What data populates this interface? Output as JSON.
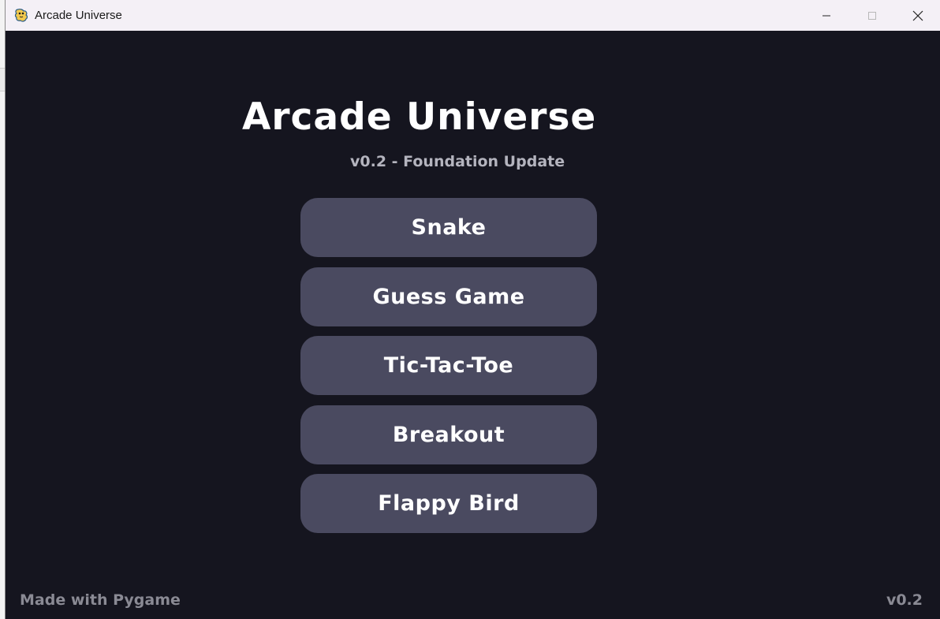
{
  "window": {
    "title": "Arcade Universe",
    "icon": "pygame-snake-icon",
    "controls": [
      "minimize-icon",
      "maximize-icon",
      "close-icon"
    ]
  },
  "game": {
    "title": "Arcade Universe",
    "subtitle": "v0.2 - Foundation Update"
  },
  "menu": {
    "items": [
      {
        "label": "Snake"
      },
      {
        "label": "Guess Game"
      },
      {
        "label": "Tic-Tac-Toe"
      },
      {
        "label": "Breakout"
      },
      {
        "label": "Flappy Bird"
      }
    ]
  },
  "footer": {
    "credit": "Made with Pygame",
    "version": "v0.2"
  },
  "colors": {
    "background": "#15151f",
    "button": "#4a4a60",
    "button_text": "#ffffff",
    "subtitle": "#b4b4be",
    "footer_text": "#8a8a94",
    "titlebar": "#f4f0f6"
  }
}
